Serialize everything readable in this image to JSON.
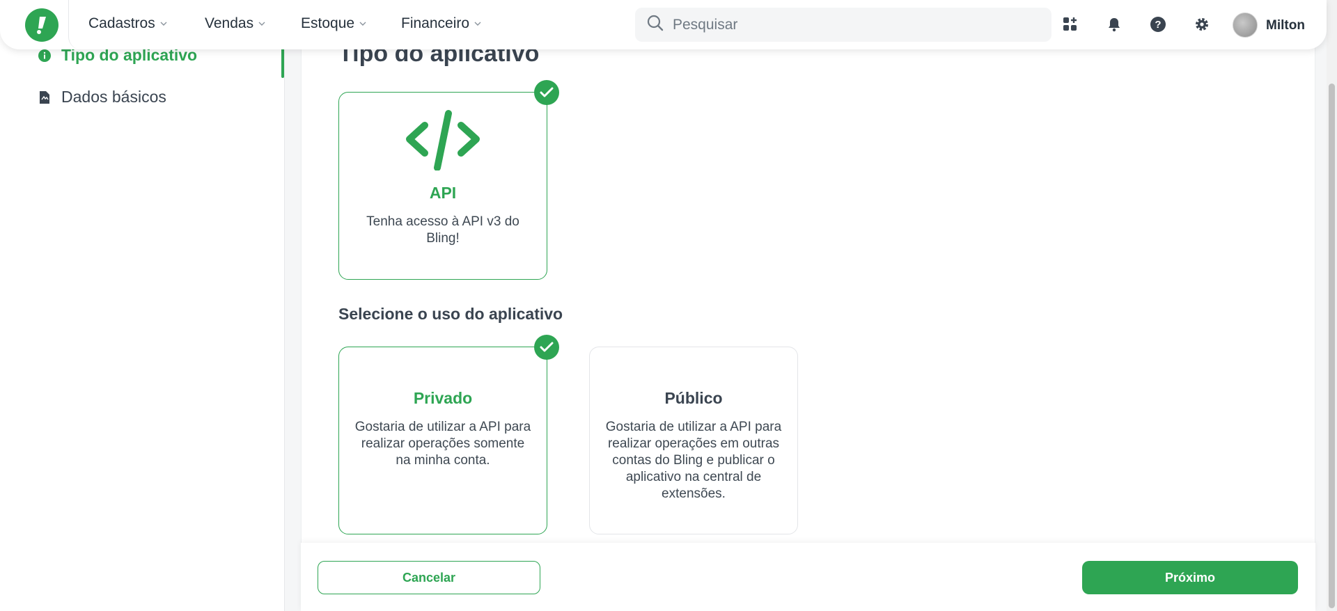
{
  "nav": {
    "items": [
      {
        "label": "Cadastros"
      },
      {
        "label": "Vendas"
      },
      {
        "label": "Estoque"
      },
      {
        "label": "Financeiro"
      }
    ],
    "search_placeholder": "Pesquisar",
    "user_name": "Milton"
  },
  "sidebar": {
    "items": [
      {
        "label": "Tipo do aplicativo",
        "icon": "info-icon",
        "active": true
      },
      {
        "label": "Dados básicos",
        "icon": "document-icon",
        "active": false
      }
    ]
  },
  "main": {
    "title": "Tipo do aplicativo",
    "type_card": {
      "title": "API",
      "description": "Tenha acesso à API v3 do Bling!",
      "icon": "code-icon",
      "selected": true
    },
    "usage_title": "Selecione o uso do aplicativo",
    "usage_cards": [
      {
        "title": "Privado",
        "description": "Gostaria de utilizar a API para realizar operações somente na minha conta.",
        "selected": true
      },
      {
        "title": "Público",
        "description": "Gostaria de utilizar a API para realizar operações em outras contas do Bling e publicar o aplicativo na central de extensões.",
        "selected": false
      }
    ]
  },
  "footer": {
    "cancel_label": "Cancelar",
    "next_label": "Próximo"
  },
  "colors": {
    "accent": "#2ea553",
    "text": "#3a4450",
    "background": "#f5f6f7"
  }
}
